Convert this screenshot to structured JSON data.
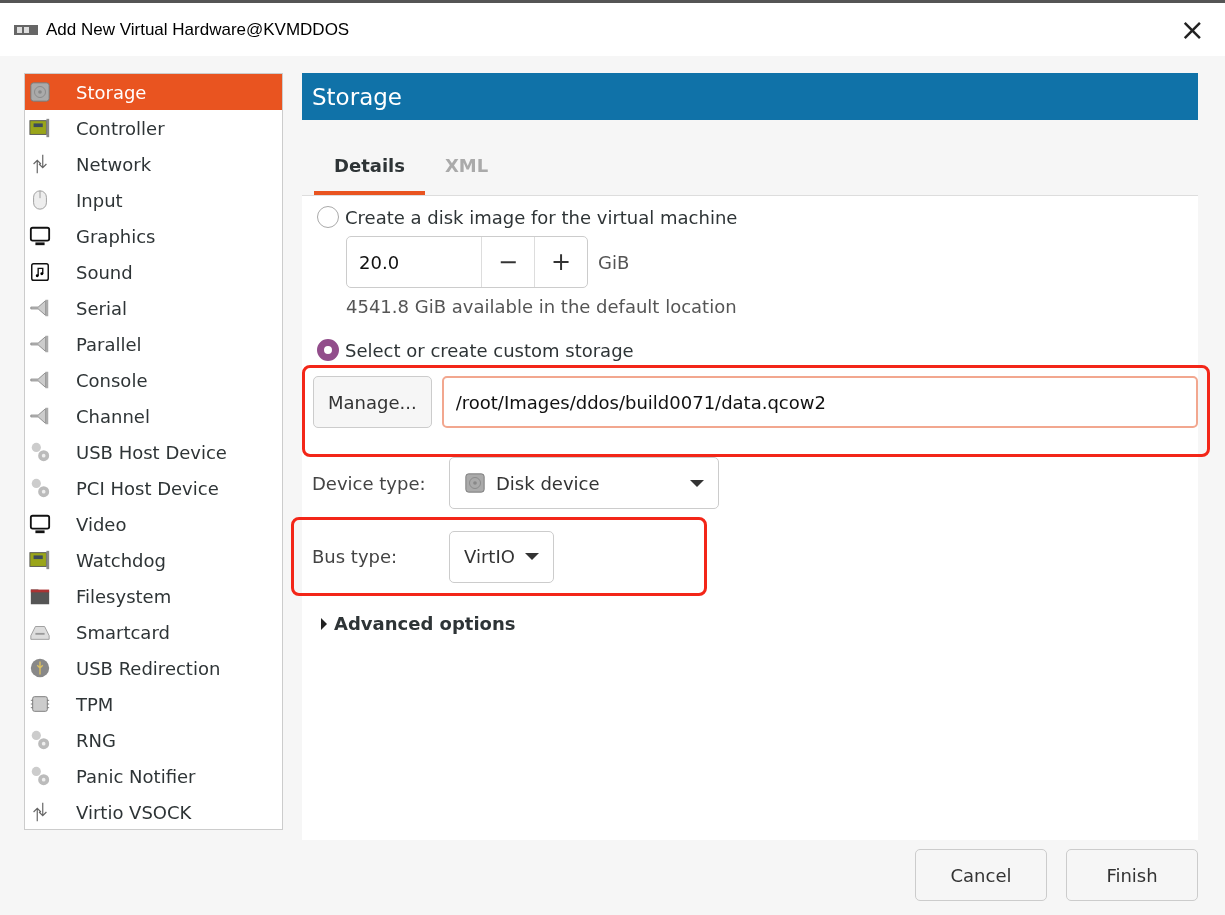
{
  "window": {
    "title": "Add New Virtual Hardware@KVMDDOS",
    "close": "×"
  },
  "sidebar": {
    "items": [
      {
        "label": "Storage",
        "kind": "disk",
        "selected": true
      },
      {
        "label": "Controller",
        "kind": "card",
        "selected": false
      },
      {
        "label": "Network",
        "kind": "arrows",
        "selected": false
      },
      {
        "label": "Input",
        "kind": "mouse",
        "selected": false
      },
      {
        "label": "Graphics",
        "kind": "monitor",
        "selected": false
      },
      {
        "label": "Sound",
        "kind": "sound",
        "selected": false
      },
      {
        "label": "Serial",
        "kind": "plug",
        "selected": false
      },
      {
        "label": "Parallel",
        "kind": "plug",
        "selected": false
      },
      {
        "label": "Console",
        "kind": "plug",
        "selected": false
      },
      {
        "label": "Channel",
        "kind": "plug",
        "selected": false
      },
      {
        "label": "USB Host Device",
        "kind": "gears",
        "selected": false
      },
      {
        "label": "PCI Host Device",
        "kind": "gears",
        "selected": false
      },
      {
        "label": "Video",
        "kind": "monitor",
        "selected": false
      },
      {
        "label": "Watchdog",
        "kind": "card",
        "selected": false
      },
      {
        "label": "Filesystem",
        "kind": "folder",
        "selected": false
      },
      {
        "label": "Smartcard",
        "kind": "reader",
        "selected": false
      },
      {
        "label": "USB Redirection",
        "kind": "usb",
        "selected": false
      },
      {
        "label": "TPM",
        "kind": "chip",
        "selected": false
      },
      {
        "label": "RNG",
        "kind": "gears",
        "selected": false
      },
      {
        "label": "Panic Notifier",
        "kind": "gears",
        "selected": false
      },
      {
        "label": "Virtio VSOCK",
        "kind": "arrows",
        "selected": false
      }
    ]
  },
  "header": "Storage",
  "tabs": [
    {
      "label": "Details",
      "selected": true
    },
    {
      "label": "XML",
      "selected": false
    }
  ],
  "create_option": {
    "label": "Create a disk image for the virtual machine",
    "selected": false,
    "size": "20.0",
    "minus": "−",
    "plus": "+",
    "unit": "GiB",
    "note": "4541.8 GiB available in the default location"
  },
  "custom_option": {
    "label": "Select or create custom storage",
    "selected": true,
    "manage_button": "Manage...",
    "path": "/root/Images/ddos/build0071/data.qcow2"
  },
  "device_type": {
    "label": "Device type:",
    "value": "Disk device"
  },
  "bus_type": {
    "label": "Bus type:",
    "value": "VirtIO"
  },
  "advanced": {
    "label": "Advanced options",
    "expanded": false
  },
  "buttons": [
    "Cancel",
    "Finish"
  ]
}
